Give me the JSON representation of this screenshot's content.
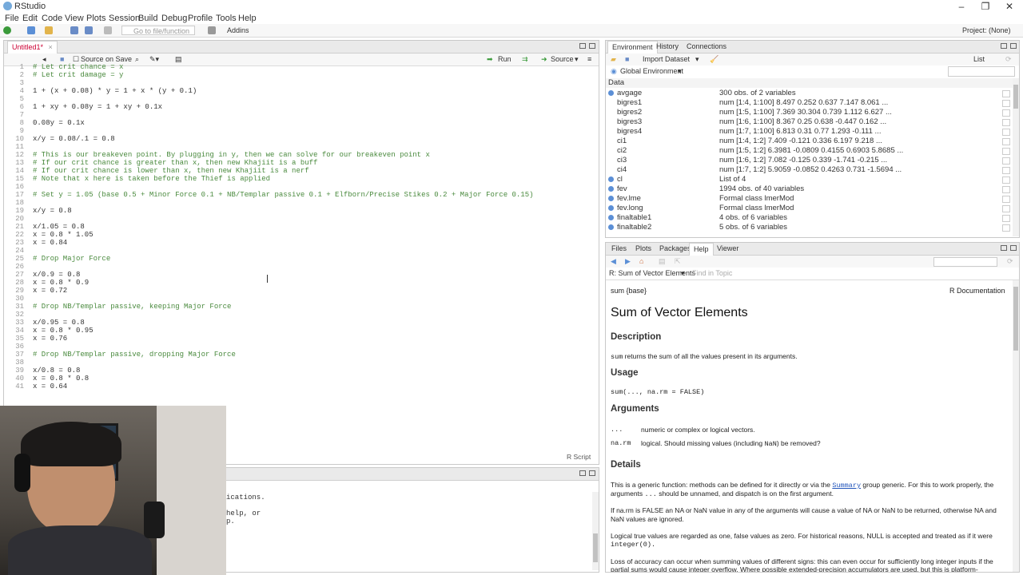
{
  "window": {
    "title": "RStudio",
    "project": "Project: (None)"
  },
  "menu": [
    "File",
    "Edit",
    "Code",
    "View",
    "Plots",
    "Session",
    "Build",
    "Debug",
    "Profile",
    "Tools",
    "Help"
  ],
  "toolbar": {
    "goto_placeholder": "Go to file/function",
    "addins": "Addins"
  },
  "editor": {
    "tab": "Untitled1*",
    "source_on_save": "Source on Save",
    "run": "Run",
    "source": "Source",
    "status": "R Script",
    "lines": [
      {
        "n": "1",
        "t": "# Let crit chance = x",
        "c": true
      },
      {
        "n": "2",
        "t": "# Let crit damage = y",
        "c": true
      },
      {
        "n": "3",
        "t": "",
        "c": false
      },
      {
        "n": "4",
        "t": "1 + (x + 0.08) * y = 1 + x * (y + 0.1)",
        "c": false
      },
      {
        "n": "5",
        "t": "",
        "c": false
      },
      {
        "n": "6",
        "t": "1 + xy + 0.08y = 1 + xy + 0.1x",
        "c": false
      },
      {
        "n": "7",
        "t": "",
        "c": false
      },
      {
        "n": "8",
        "t": "0.08y = 0.1x",
        "c": false
      },
      {
        "n": "9",
        "t": "",
        "c": false
      },
      {
        "n": "10",
        "t": "x/y = 0.08/.1 = 0.8",
        "c": false
      },
      {
        "n": "11",
        "t": "",
        "c": false
      },
      {
        "n": "12",
        "t": "# This is our breakeven point. By plugging in y, then we can solve for our breakeven point x",
        "c": true
      },
      {
        "n": "13",
        "t": "# If our crit chance is greater than x, then new Khajiit is a buff",
        "c": true
      },
      {
        "n": "14",
        "t": "# If our crit chance is lower than x, then new Khajiit is a nerf",
        "c": true
      },
      {
        "n": "15",
        "t": "# Note that x here is taken before the Thief is applied",
        "c": true
      },
      {
        "n": "16",
        "t": "",
        "c": false
      },
      {
        "n": "17",
        "t": "# Set y = 1.05 (base 0.5 + Minor Force 0.1 + NB/Templar passive 0.1 + Elfborn/Precise Stikes 0.2 + Major Force 0.15)",
        "c": true
      },
      {
        "n": "18",
        "t": "",
        "c": false
      },
      {
        "n": "19",
        "t": "x/y = 0.8",
        "c": false
      },
      {
        "n": "20",
        "t": "",
        "c": false
      },
      {
        "n": "21",
        "t": "x/1.05 = 0.8",
        "c": false
      },
      {
        "n": "22",
        "t": "x = 0.8 * 1.05",
        "c": false
      },
      {
        "n": "23",
        "t": "x = 0.84",
        "c": false
      },
      {
        "n": "24",
        "t": "",
        "c": false
      },
      {
        "n": "25",
        "t": "# Drop Major Force",
        "c": true
      },
      {
        "n": "26",
        "t": "",
        "c": false
      },
      {
        "n": "27",
        "t": "x/0.9 = 0.8",
        "c": false
      },
      {
        "n": "28",
        "t": "x = 0.8 * 0.9",
        "c": false
      },
      {
        "n": "29",
        "t": "x = 0.72",
        "c": false
      },
      {
        "n": "30",
        "t": "",
        "c": false
      },
      {
        "n": "31",
        "t": "# Drop NB/Templar passive, keeping Major Force",
        "c": true
      },
      {
        "n": "32",
        "t": "",
        "c": false
      },
      {
        "n": "33",
        "t": "x/0.95 = 0.8",
        "c": false
      },
      {
        "n": "34",
        "t": "x = 0.8 * 0.95",
        "c": false
      },
      {
        "n": "35",
        "t": "x = 0.76",
        "c": false
      },
      {
        "n": "36",
        "t": "",
        "c": false
      },
      {
        "n": "37",
        "t": "# Drop NB/Templar passive, dropping Major Force",
        "c": true
      },
      {
        "n": "38",
        "t": "",
        "c": false
      },
      {
        "n": "39",
        "t": "x/0.8 = 0.8",
        "c": false
      },
      {
        "n": "40",
        "t": "x = 0.8 * 0.8",
        "c": false
      },
      {
        "n": "41",
        "t": "x = 0.64",
        "c": false
      }
    ]
  },
  "console": {
    "lines": [
      "ications.",
      "",
      "help, or",
      "p."
    ]
  },
  "env": {
    "tabs": [
      "Environment",
      "History",
      "Connections"
    ],
    "import": "Import Dataset",
    "list": "List",
    "scope": "Global Environment",
    "section": "Data",
    "rows": [
      {
        "name": "avgage",
        "value": "300 obs. of 2 variables",
        "bullet": true
      },
      {
        "name": "bigres1",
        "value": "num [1:4, 1:100] 8.497 0.252 0.637 7.147 8.061 ...",
        "bullet": false
      },
      {
        "name": "bigres2",
        "value": "num [1:5, 1:100] 7.369 30.304 0.739 1.112 6.627 ...",
        "bullet": false
      },
      {
        "name": "bigres3",
        "value": "num [1:6, 1:100] 8.367 0.25 0.638 -0.447 0.162 ...",
        "bullet": false
      },
      {
        "name": "bigres4",
        "value": "num [1:7, 1:100] 6.813 0.31 0.77 1.293 -0.111 ...",
        "bullet": false
      },
      {
        "name": "ci1",
        "value": "num [1:4, 1:2] 7.409 -0.121 0.336 6.197 9.218 ...",
        "bullet": false
      },
      {
        "name": "ci2",
        "value": "num [1:5, 1:2] 6.3981 -0.0809 0.4155 0.6903 5.8685 ...",
        "bullet": false
      },
      {
        "name": "ci3",
        "value": "num [1:6, 1:2] 7.082 -0.125 0.339 -1.741 -0.215 ...",
        "bullet": false
      },
      {
        "name": "ci4",
        "value": "num [1:7, 1:2] 5.9059 -0.0852 0.4263 0.731 -1.5694 ...",
        "bullet": false
      },
      {
        "name": "cl",
        "value": "List of 4",
        "bullet": true
      },
      {
        "name": "fev",
        "value": "1994 obs. of 40 variables",
        "bullet": true
      },
      {
        "name": "fev.lme",
        "value": "Formal class lmerMod",
        "bullet": true
      },
      {
        "name": "fev.long",
        "value": "Formal class lmerMod",
        "bullet": true
      },
      {
        "name": "finaltable1",
        "value": "4 obs. of 6 variables",
        "bullet": true
      },
      {
        "name": "finaltable2",
        "value": "5 obs. of 6 variables",
        "bullet": true
      }
    ]
  },
  "help": {
    "tabs": [
      "Files",
      "Plots",
      "Packages",
      "Help",
      "Viewer"
    ],
    "topic_select": "R: Sum of Vector Elements",
    "find_in_topic": "Find in Topic",
    "pkg": "sum {base}",
    "rdoc": "R Documentation",
    "title": "Sum of Vector Elements",
    "description_h": "Description",
    "description_code": "sum",
    "description_rest": " returns the sum of all the values present in its arguments.",
    "usage_h": "Usage",
    "usage": "sum(..., na.rm = FALSE)",
    "arguments_h": "Arguments",
    "arg1_name": "...",
    "arg1_desc": "numeric or complex or logical vectors.",
    "arg2_name": "na.rm",
    "arg2_desc_a": "logical. Should missing values (including ",
    "arg2_desc_code": "NaN",
    "arg2_desc_b": ") be removed?",
    "details_h": "Details",
    "details1_a": "This is a generic function: methods can be defined for it directly or via the ",
    "details1_link": "Summary",
    "details1_b": " group generic. For this to work properly, the",
    "details1_line2_a": "arguments ",
    "details1_line2_code": "...",
    "details1_line2_b": " should be unnamed, and dispatch is on the first argument.",
    "details2_line1": "If na.rm is FALSE an NA or NaN value in any of the arguments will cause a value of NA or NaN to be returned, otherwise NA and",
    "details2_line2": "NaN values are ignored.",
    "details3_line1": "Logical true values are regarded as one, false values as zero. For historical reasons, NULL is accepted and treated as if it were",
    "details3_line2": "integer(0).",
    "details4_line1": "Loss of accuracy can occur when summing values of different signs: this can even occur for sufficiently long integer inputs if the",
    "details4_line2": "partial sums would cause integer overflow. Where possible extended-precision accumulators are used, but this is platform-"
  },
  "colors": {
    "accent": "#75aadb",
    "comment": "#4a8a3e",
    "link": "#2255bb"
  }
}
